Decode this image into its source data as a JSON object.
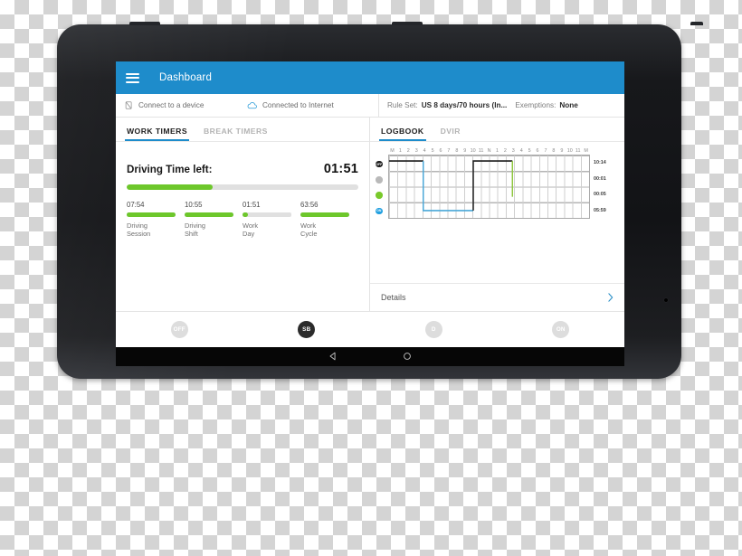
{
  "app": {
    "title": "Dashboard",
    "menu_icon": "hamburger-icon"
  },
  "status": {
    "device": {
      "icon": "device-disconnected-icon",
      "label": "Connect to a device"
    },
    "internet": {
      "icon": "cloud-icon",
      "label": "Connected to Internet"
    },
    "rule_set_label": "Rule Set:",
    "rule_set_value": "US 8 days/70 hours (In...",
    "exemptions_label": "Exemptions:",
    "exemptions_value": "None"
  },
  "left_panel": {
    "tabs": [
      {
        "label": "WORK TIMERS",
        "active": true
      },
      {
        "label": "BREAK TIMERS",
        "active": false
      }
    ],
    "driving_label": "Driving Time left:",
    "driving_value": "01:51",
    "main_progress_percent": 37,
    "timers": [
      {
        "value": "07:54",
        "name": "Driving\nSession",
        "percent": 100
      },
      {
        "value": "10:55",
        "name": "Driving\nShift",
        "percent": 100
      },
      {
        "value": "01:51",
        "name": "Work\nDay",
        "percent": 12
      },
      {
        "value": "63:56",
        "name": "Work\nCycle",
        "percent": 100
      }
    ]
  },
  "right_panel": {
    "tabs": [
      {
        "label": "LOGBOOK",
        "active": true
      },
      {
        "label": "DVIR",
        "active": false
      }
    ],
    "details_label": "Details",
    "details_chevron": "chevron-right-icon",
    "hour_labels": [
      "M",
      "1",
      "2",
      "3",
      "4",
      "5",
      "6",
      "7",
      "8",
      "9",
      "10",
      "11",
      "N",
      "1",
      "2",
      "3",
      "4",
      "5",
      "6",
      "7",
      "8",
      "9",
      "10",
      "11",
      "M"
    ],
    "rows": [
      {
        "code": "OFF",
        "color": "#1c1c1c",
        "total": "10:14"
      },
      {
        "code": "SB",
        "color": "#b9b9b9",
        "total": "00:01"
      },
      {
        "code": "D",
        "color": "#79c92b",
        "total": "00:05"
      },
      {
        "code": "ON",
        "color": "#22a0e0",
        "total": "05:59"
      }
    ]
  },
  "duty_buttons": [
    {
      "label": "OFF",
      "selected": false
    },
    {
      "label": "SB",
      "selected": true
    },
    {
      "label": "D",
      "selected": false
    },
    {
      "label": "ON",
      "selected": false
    }
  ],
  "navbar": {
    "back": "back-triangle-icon",
    "home": "home-circle-icon"
  },
  "colors": {
    "accent": "#1e8ccb",
    "green": "#6dc72b",
    "track": "#e0e0e0"
  }
}
